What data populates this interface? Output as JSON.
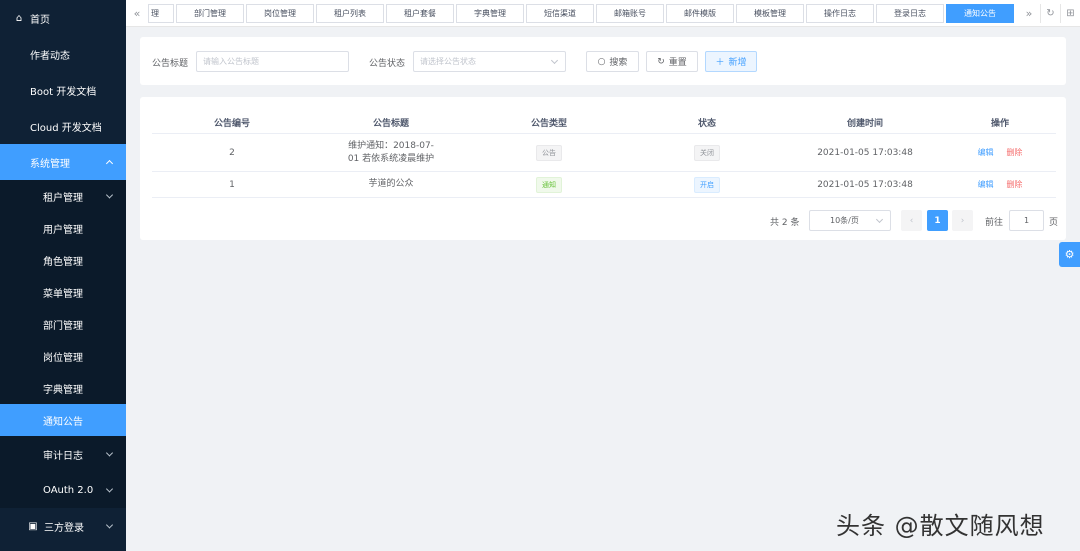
{
  "sidebar": {
    "home": "首页",
    "author": "作者动态",
    "boot_docs": "Boot 开发文档",
    "cloud_docs": "Cloud 开发文档",
    "system": "系统管理",
    "sub": [
      "租户管理",
      "用户管理",
      "角色管理",
      "菜单管理",
      "部门管理",
      "岗位管理",
      "字典管理",
      "通知公告",
      "审计日志",
      "OAuth 2.0"
    ],
    "third": "三方登录"
  },
  "tabs": [
    "理",
    "部门管理",
    "岗位管理",
    "租户列表",
    "租户套餐",
    "字典管理",
    "短信渠道",
    "邮箱账号",
    "邮件模版",
    "模板管理",
    "操作日志",
    "登录日志",
    "通知公告"
  ],
  "search": {
    "title_label": "公告标题",
    "title_placeholder": "请输入公告标题",
    "status_label": "公告状态",
    "status_placeholder": "请选择公告状态",
    "search_btn": "搜索",
    "reset_btn": "重置",
    "add_btn": "新增"
  },
  "table": {
    "headers": [
      "公告编号",
      "公告标题",
      "公告类型",
      "状态",
      "创建时间",
      "操作"
    ],
    "rows": [
      {
        "id": "2",
        "title": "维护通知：2018-07-01 若依系统凌晨维护",
        "type": "公告",
        "status": "关闭",
        "created": "2021-01-05 17:03:48",
        "edit": "编辑",
        "delete": "删除"
      },
      {
        "id": "1",
        "title": "芋道的公众",
        "type": "通知",
        "status": "开启",
        "created": "2021-01-05 17:03:48",
        "edit": "编辑",
        "delete": "删除"
      }
    ]
  },
  "pager": {
    "total": "共 2 条",
    "size": "10条/页",
    "current": "1",
    "goto": "前往",
    "goto_value": "1",
    "unit": "页"
  },
  "watermark": "头条 @散文随风想",
  "icons": {
    "home": "home-icon",
    "system": "system-icon",
    "third": "third-party-icon",
    "settings": "gear-icon"
  },
  "colors": {
    "sidebar": "#0f2135",
    "accent": "#409eff"
  }
}
